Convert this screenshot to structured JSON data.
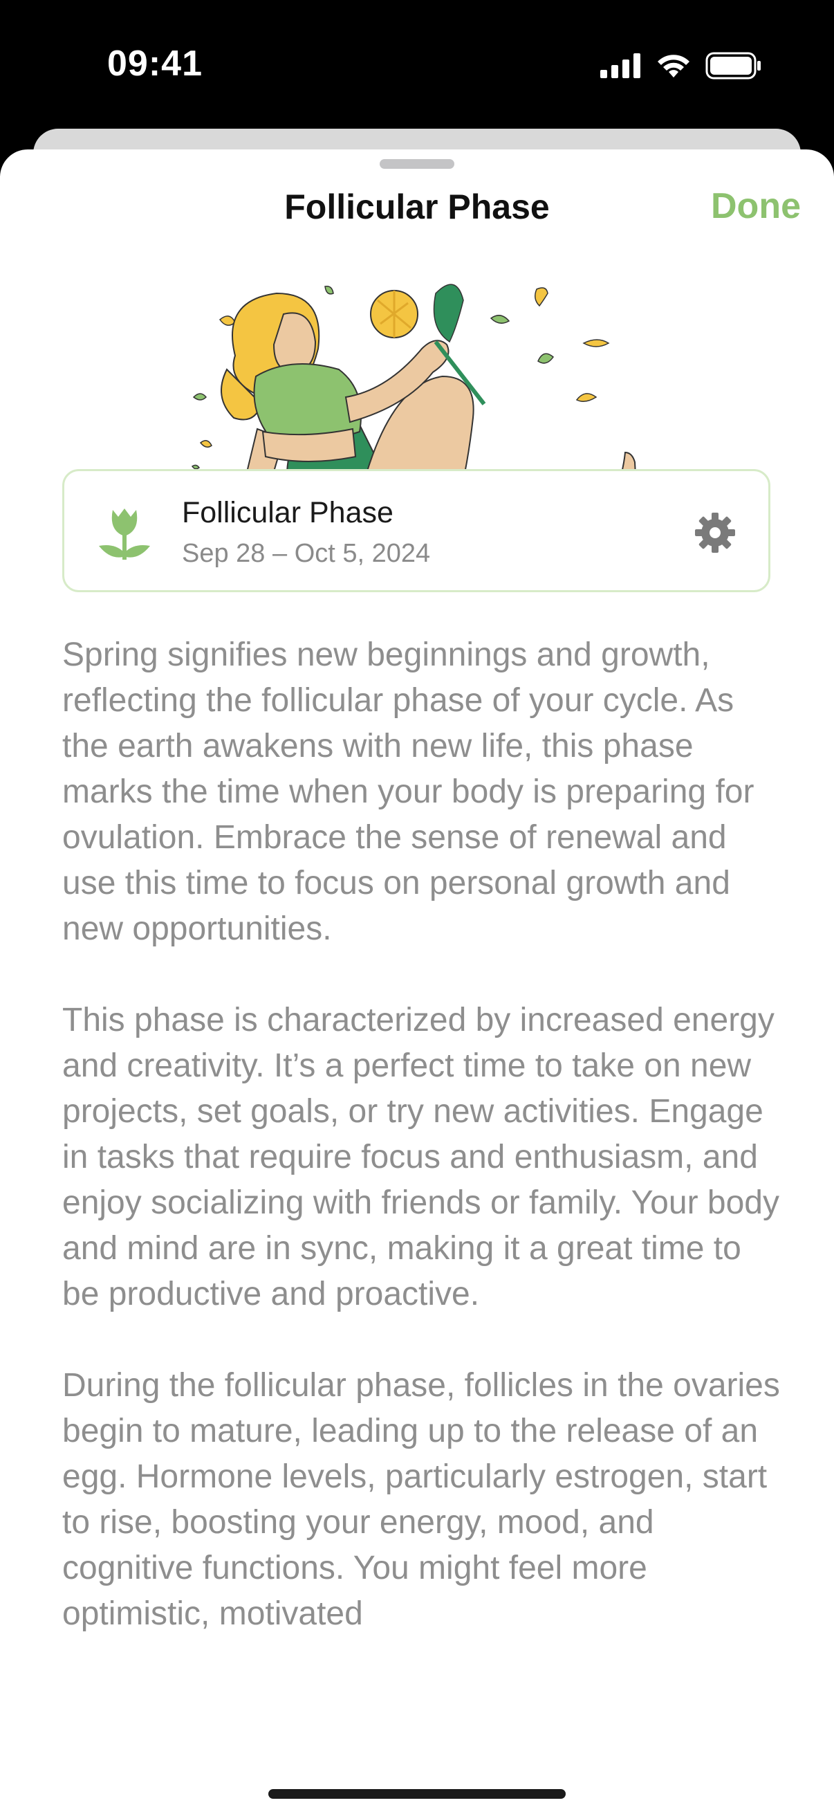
{
  "status_bar": {
    "time": "09:41"
  },
  "sheet": {
    "title": "Follicular Phase",
    "done_label": "Done",
    "accent_color": "#8dc26f"
  },
  "phase_card": {
    "name": "Follicular Phase",
    "dates": "Sep 28 – Oct 5, 2024",
    "icon": "tulip-icon",
    "settings_icon": "gear-icon"
  },
  "body": {
    "paragraphs": [
      "Spring signifies new beginnings and growth, reflecting the follicular phase of your cycle. As the earth awakens with new life, this phase marks the time when your body is preparing for ovulation. Embrace the sense of renewal and use this time to focus on personal growth and new opportunities.",
      "This phase is characterized by increased energy and creativity. It’s a perfect time to take on new projects, set goals, or try new activities. Engage in tasks that require focus and enthusiasm, and enjoy socializing with friends or family. Your body and mind are in sync, making it a great time to be productive and proactive.",
      "During the follicular phase, follicles in the ovaries begin to mature, leading up to the release of an egg. Hormone levels, particularly estrogen, start to rise, boosting your energy, mood, and cognitive functions. You might feel more optimistic, motivated"
    ]
  }
}
